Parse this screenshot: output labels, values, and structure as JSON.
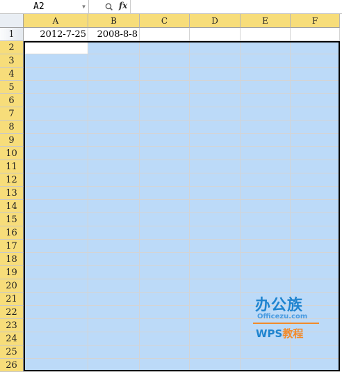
{
  "formula_bar": {
    "name_box": "A2",
    "zoom_icon": "zoom-lens-icon",
    "fx_label": "fx",
    "formula": ""
  },
  "columns": [
    "A",
    "B",
    "C",
    "D",
    "E",
    "F"
  ],
  "rows": [
    "1",
    "2",
    "3",
    "4",
    "5",
    "6",
    "7",
    "8",
    "9",
    "10",
    "11",
    "12",
    "13",
    "14",
    "15",
    "16",
    "17",
    "18",
    "19",
    "20",
    "21",
    "22",
    "23",
    "24",
    "25",
    "26"
  ],
  "cells": {
    "A1": "2012-7-25",
    "B1": "2008-8-8"
  },
  "selection": {
    "range": "A2:F26",
    "active_cell": "A2",
    "fill_color": "#bcdaf8",
    "header_highlight_color": "#f7dd7a"
  },
  "watermark": {
    "title": "办公族",
    "site": "Officezu.com",
    "brand": "WPS",
    "brand_suffix": "教程"
  }
}
